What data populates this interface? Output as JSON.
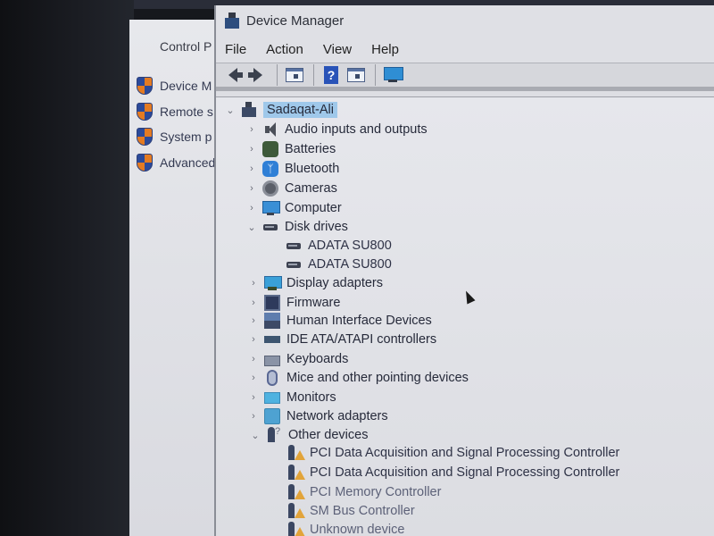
{
  "background_window": {
    "title": "Control P",
    "links": [
      {
        "label": "Device M",
        "icon": "uac-shield-icon"
      },
      {
        "label": "Remote s",
        "icon": "uac-shield-icon"
      },
      {
        "label": "System p",
        "icon": "uac-shield-icon"
      },
      {
        "label": "Advanced",
        "icon": "uac-shield-icon"
      }
    ]
  },
  "window": {
    "title": "Device Manager",
    "icon": "device-manager-icon"
  },
  "menubar": {
    "items": [
      "File",
      "Action",
      "View",
      "Help"
    ]
  },
  "toolbar": {
    "buttons": [
      {
        "name": "back",
        "icon": "arrow-left-icon"
      },
      {
        "name": "forward",
        "icon": "arrow-right-icon"
      },
      {
        "name": "show-hide-console-tree",
        "icon": "console-tree-icon"
      },
      {
        "name": "help",
        "icon": "help-icon",
        "glyph": "?"
      },
      {
        "name": "action-pane",
        "icon": "action-pane-icon"
      },
      {
        "name": "scan-hardware",
        "icon": "monitor-icon"
      }
    ]
  },
  "tree": {
    "root": {
      "label": "Sadaqat-Ali",
      "expanded": true,
      "selected": true
    },
    "categories": [
      {
        "label": "Audio inputs and outputs",
        "icon": "speaker-icon",
        "expanded": false
      },
      {
        "label": "Batteries",
        "icon": "battery-icon",
        "expanded": false
      },
      {
        "label": "Bluetooth",
        "icon": "bluetooth-icon",
        "expanded": false
      },
      {
        "label": "Cameras",
        "icon": "camera-icon",
        "expanded": false
      },
      {
        "label": "Computer",
        "icon": "computer-icon",
        "expanded": false
      },
      {
        "label": "Disk drives",
        "icon": "disk-drive-icon",
        "expanded": true,
        "children": [
          {
            "label": "ADATA SU800",
            "icon": "disk-drive-icon"
          },
          {
            "label": "ADATA SU800",
            "icon": "disk-drive-icon"
          }
        ]
      },
      {
        "label": "Display adapters",
        "icon": "display-adapter-icon",
        "expanded": false
      },
      {
        "label": "Firmware",
        "icon": "firmware-icon",
        "expanded": false
      },
      {
        "label": "Human Interface Devices",
        "icon": "hid-icon",
        "expanded": false
      },
      {
        "label": "IDE ATA/ATAPI controllers",
        "icon": "ide-controller-icon",
        "expanded": false
      },
      {
        "label": "Keyboards",
        "icon": "keyboard-icon",
        "expanded": false
      },
      {
        "label": "Mice and other pointing devices",
        "icon": "mouse-icon",
        "expanded": false
      },
      {
        "label": "Monitors",
        "icon": "monitor-icon",
        "expanded": false
      },
      {
        "label": "Network adapters",
        "icon": "network-adapter-icon",
        "expanded": false
      },
      {
        "label": "Other devices",
        "icon": "unknown-device-icon",
        "expanded": true,
        "children": [
          {
            "label": "PCI Data Acquisition and Signal Processing Controller",
            "icon": "warning-device-icon"
          },
          {
            "label": "PCI Data Acquisition and Signal Processing Controller",
            "icon": "warning-device-icon"
          },
          {
            "label": "PCI Memory Controller",
            "icon": "warning-device-icon"
          },
          {
            "label": "SM Bus Controller",
            "icon": "warning-device-icon"
          },
          {
            "label": "Unknown device",
            "icon": "warning-device-icon"
          }
        ]
      }
    ]
  },
  "colors": {
    "selection": "#9fc8ea",
    "warning": "#e2a43a",
    "window_bg": "#dddee3"
  }
}
